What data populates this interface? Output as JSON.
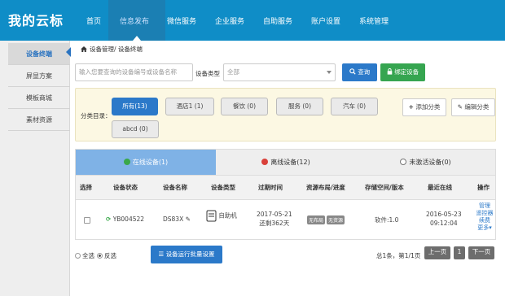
{
  "brand": "我的云标",
  "nav": [
    "首页",
    "信息发布",
    "微信服务",
    "企业服务",
    "自助服务",
    "账户设置",
    "系统管理"
  ],
  "sidebar": [
    "设备终端",
    "屏显方案",
    "模板商城",
    "素材资源"
  ],
  "breadcrumb": "设备管理/ 设备终端",
  "search": {
    "placeholder": "输入您要查询的设备编号或设备名称"
  },
  "type_label": "设备类型",
  "type_select": "全部",
  "query_button": "查询",
  "bind_button": "绑定设备",
  "category": {
    "label": "分类目录：",
    "items": [
      "所有(13)",
      "酒店1 (1)",
      "餐饮 (0)",
      "服务 (0)",
      "汽车 (0)",
      "abcd (0)"
    ],
    "add": "添加分类",
    "edit": "编辑分类"
  },
  "tabs": [
    "在线设备(1)",
    "离线设备(12)",
    "未激活设备(0)"
  ],
  "table": {
    "headers": [
      "选择",
      "设备状态",
      "设备名称",
      "设备类型",
      "过期时间",
      "资源布局/进度",
      "存储空间/版本",
      "最近在线",
      "操作"
    ],
    "row": {
      "status": "YB004522",
      "name": "DS83X",
      "type": "自助机",
      "expire_date": "2017-05-21",
      "expire_left": "还剩362天",
      "tags": [
        "无布局",
        "无资源"
      ],
      "storage": "软件:1.0",
      "last_date": "2016-05-23",
      "last_time": "09:12:04",
      "ops": [
        "管理",
        "遥控器",
        "续费",
        "更多▾"
      ]
    }
  },
  "footer": {
    "select_all": "全选",
    "invert": "反选",
    "batch_button": "设备运行批量设置",
    "page_info": "总1条，第1/1页",
    "prev": "上一页",
    "page": "1",
    "next": "下一页"
  },
  "colors": {
    "topbar": "#0f8dc7",
    "primary": "#2b79c9",
    "success": "#36a550",
    "panel": "#fcf8e3"
  }
}
